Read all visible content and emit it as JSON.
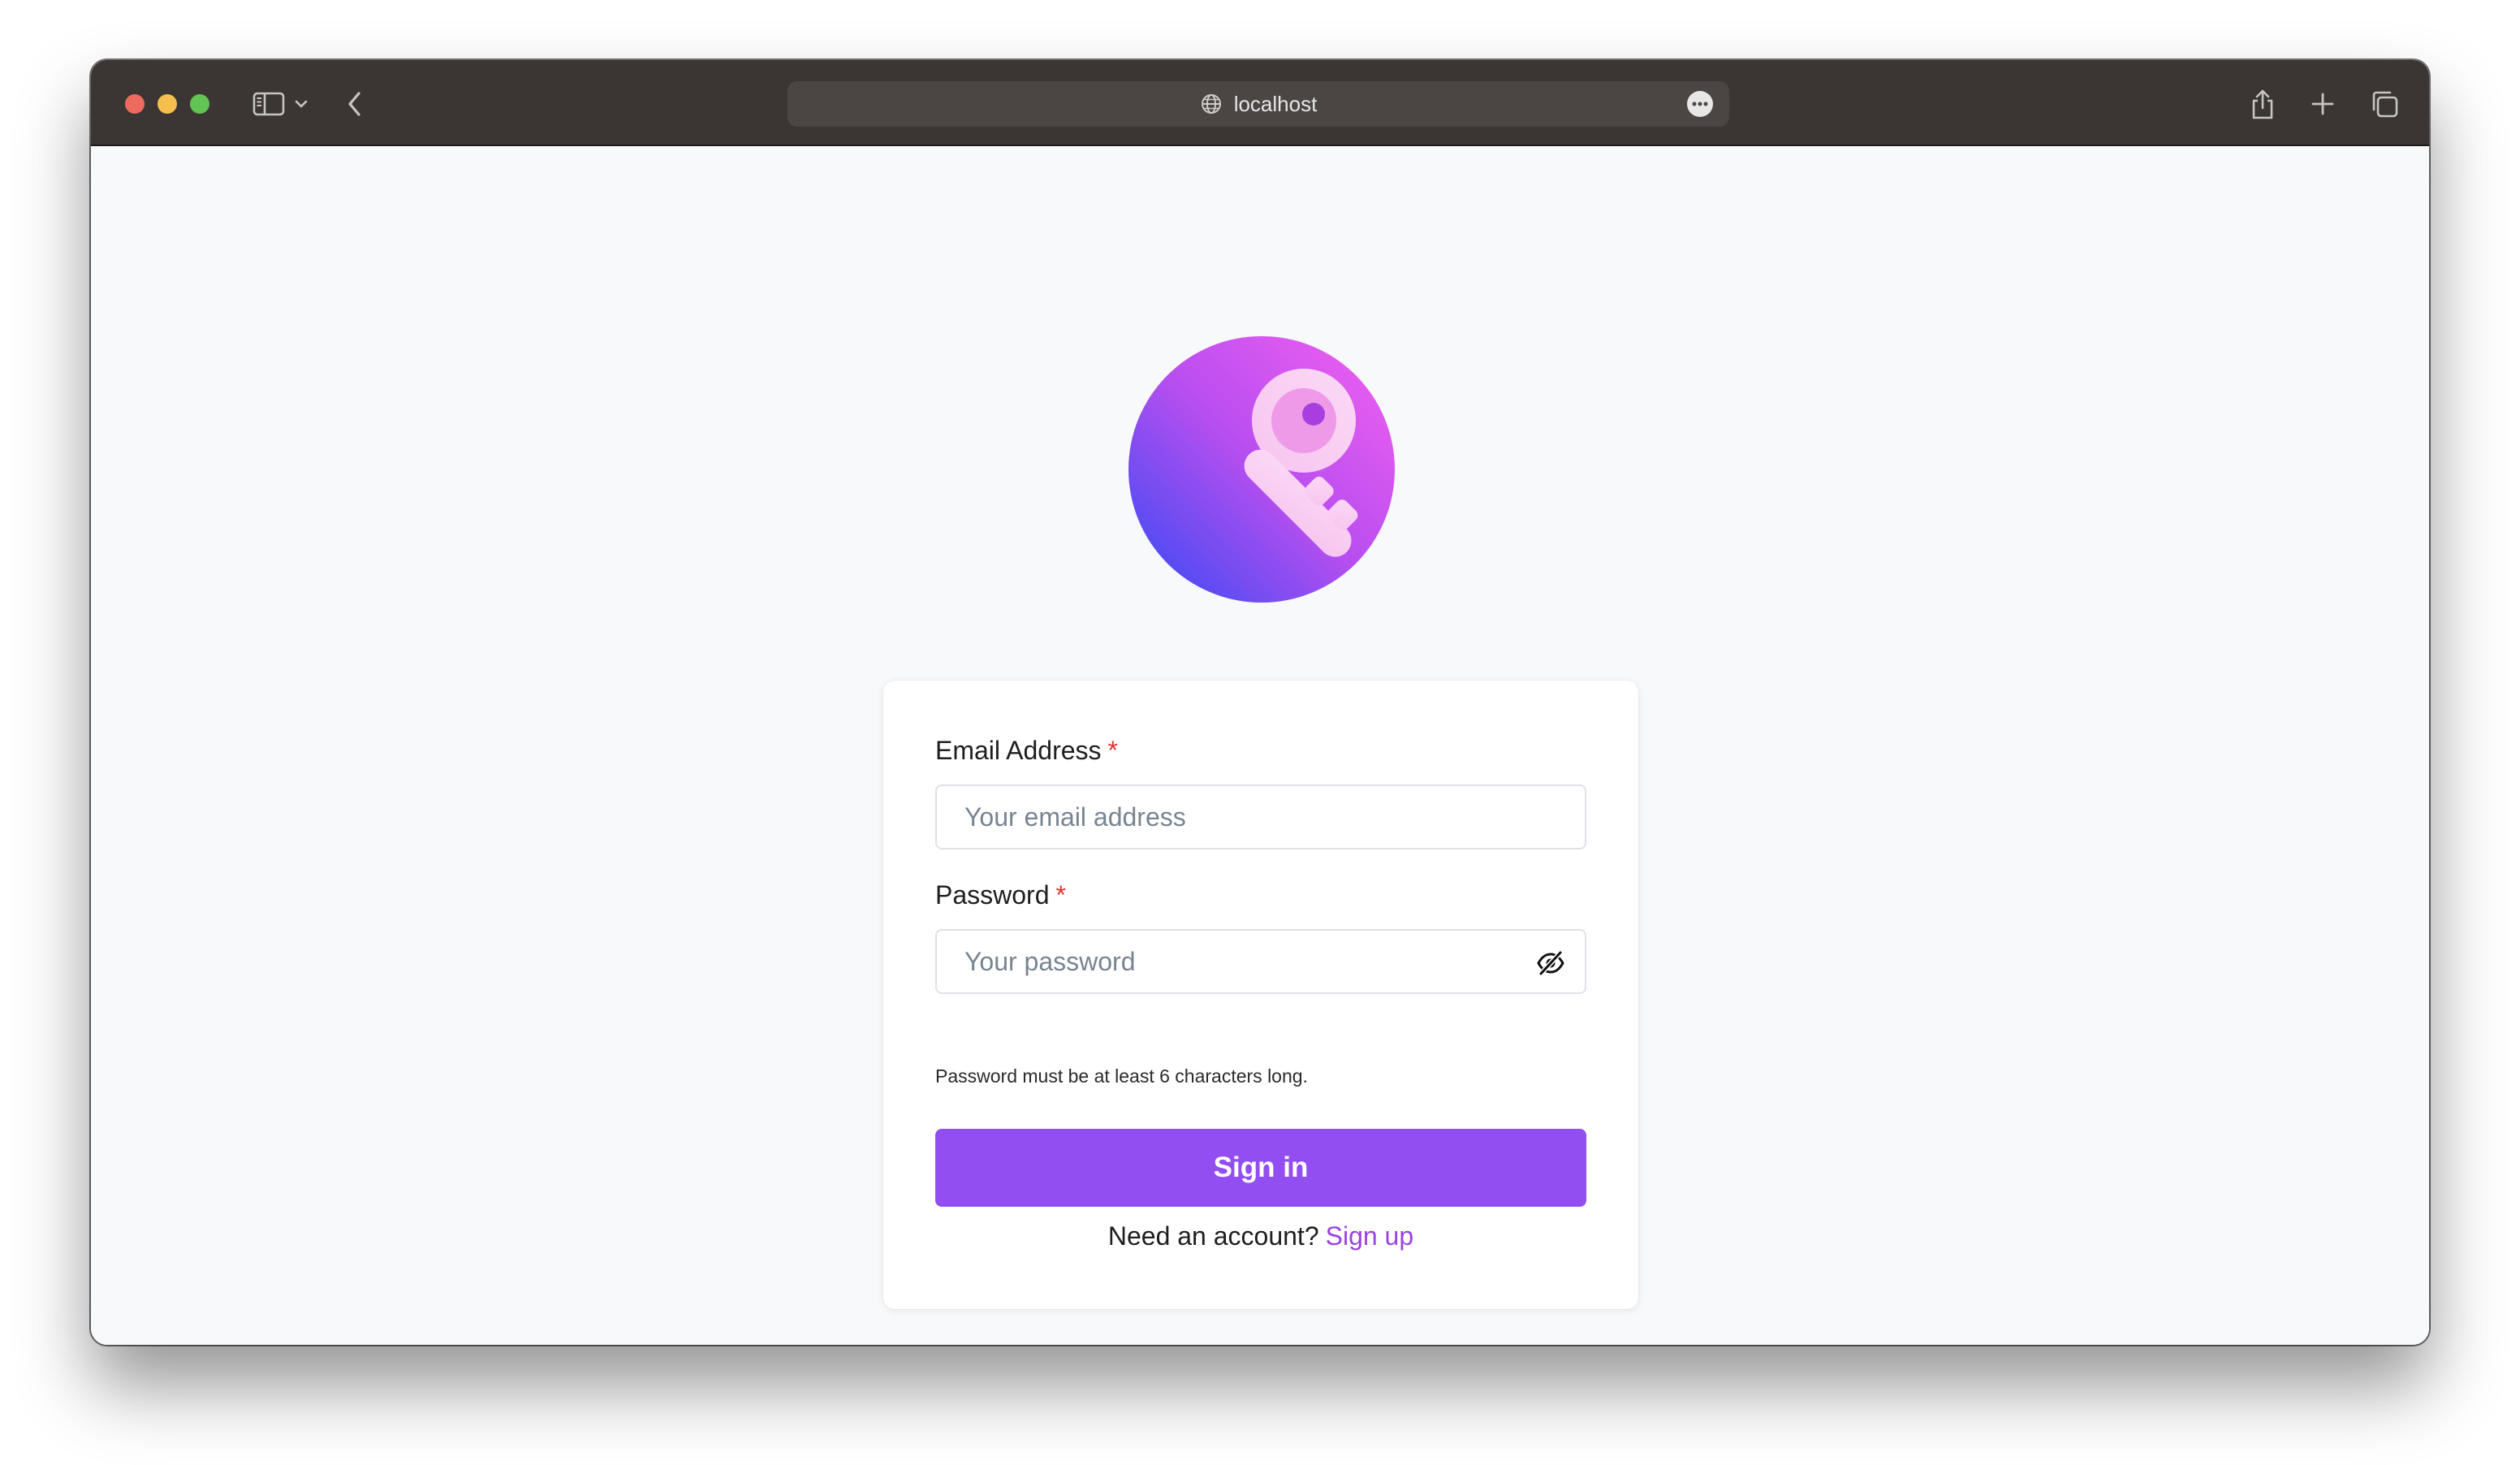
{
  "browser": {
    "url": "localhost"
  },
  "colors": {
    "accent": "#924ef0",
    "link": "#9a43e0",
    "required": "#e03131",
    "logo_gradient": [
      "#4b4cf2",
      "#b84ef0",
      "#e85df0"
    ]
  },
  "icons": {
    "logo": "key-icon",
    "password_toggle": "eye-slash-icon"
  },
  "form": {
    "email": {
      "label": "Email Address",
      "required_mark": "*",
      "placeholder": "Your email address",
      "value": ""
    },
    "password": {
      "label": "Password",
      "required_mark": "*",
      "placeholder": "Your password",
      "value": "",
      "hint": "Password must be at least 6 characters long."
    },
    "submit_label": "Sign in",
    "footer_text": "Need an account?",
    "footer_link": "Sign up"
  }
}
